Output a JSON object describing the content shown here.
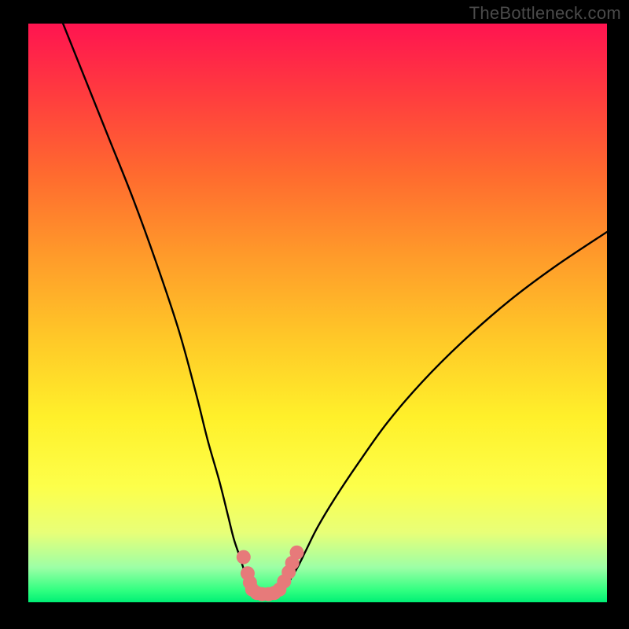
{
  "watermark": "TheBottleneck.com",
  "chart_data": {
    "type": "line",
    "title": "",
    "xlabel": "",
    "ylabel": "",
    "xlim": [
      0,
      100
    ],
    "ylim": [
      0,
      100
    ],
    "series": [
      {
        "name": "left-curve",
        "x": [
          6,
          10,
          14,
          18,
          22,
          26,
          29,
          31,
          33,
          34.5,
          35.5,
          36.5,
          37.3,
          38,
          38.7
        ],
        "y": [
          100,
          90,
          80,
          70,
          59,
          47,
          36,
          28,
          21,
          15,
          11,
          8,
          5.5,
          3.5,
          2
        ]
      },
      {
        "name": "right-curve",
        "x": [
          44,
          45,
          46.5,
          48,
          50,
          53,
          57,
          62,
          68,
          75,
          83,
          91,
          100
        ],
        "y": [
          2,
          3.5,
          6,
          9,
          13,
          18,
          24,
          31,
          38,
          45,
          52,
          58,
          64
        ]
      }
    ],
    "markers": {
      "name": "dot-cluster",
      "color": "#e77a7a",
      "points": [
        {
          "x": 37.2,
          "y": 7.8
        },
        {
          "x": 37.9,
          "y": 5.0
        },
        {
          "x": 38.3,
          "y": 3.4
        },
        {
          "x": 38.7,
          "y": 2.2
        },
        {
          "x": 39.5,
          "y": 1.6
        },
        {
          "x": 40.4,
          "y": 1.4
        },
        {
          "x": 41.5,
          "y": 1.4
        },
        {
          "x": 42.5,
          "y": 1.6
        },
        {
          "x": 43.4,
          "y": 2.2
        },
        {
          "x": 44.2,
          "y": 3.6
        },
        {
          "x": 45.0,
          "y": 5.2
        },
        {
          "x": 45.6,
          "y": 6.8
        },
        {
          "x": 46.4,
          "y": 8.6
        }
      ]
    },
    "colors": {
      "curve": "#000000",
      "marker": "#e77a7a",
      "background_top": "#ff1450",
      "background_bottom": "#00ef75",
      "frame": "#000000"
    }
  }
}
